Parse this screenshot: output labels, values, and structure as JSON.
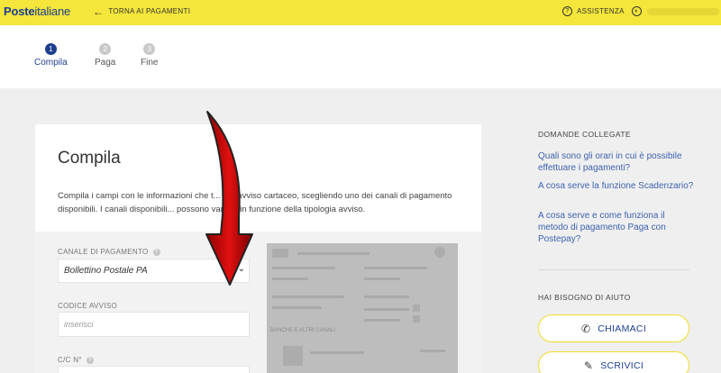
{
  "header": {
    "logo_bold": "Poste",
    "logo_light": "italiane",
    "back_label": "TORNA AI PAGAMENTI",
    "assist_label": "ASSISTENZA",
    "colors": {
      "bar": "#f4e63a",
      "brand": "#1d3f8f"
    }
  },
  "steps": [
    {
      "num": "1",
      "label": "Compila",
      "active": true
    },
    {
      "num": "2",
      "label": "Paga",
      "active": false
    },
    {
      "num": "3",
      "label": "Fine",
      "active": false
    }
  ],
  "card": {
    "title": "Compila",
    "description": "Compila i campi con le informazioni che t... sull'avviso cartaceo, scegliendo uno dei canali di pagamento disponibili. I canali disponibili... possono variare in funzione della tipologia avviso."
  },
  "form": {
    "channel_label": "CANALE DI PAGAMENTO",
    "channel_value": "Bollettino Postale PA",
    "code_label": "CODICE AVVISO",
    "code_placeholder": "inserisci",
    "cc_label": "C/C N°"
  },
  "preview": {
    "section_label": "BANCHE E ALTRI CANALI"
  },
  "sidebar": {
    "related_title": "DOMANDE COLLEGATE",
    "faqs": [
      "Quali sono gli orari in cui è possibile effettuare i pagamenti?",
      "A cosa serve la funzione Scadenzario?",
      "A cosa serve e come funziona il metodo di pagamento Paga con Postepay?"
    ],
    "help_title": "HAI BISOGNO DI AIUTO",
    "call_label": "CHIAMACI",
    "write_label": "SCRIVICI"
  }
}
